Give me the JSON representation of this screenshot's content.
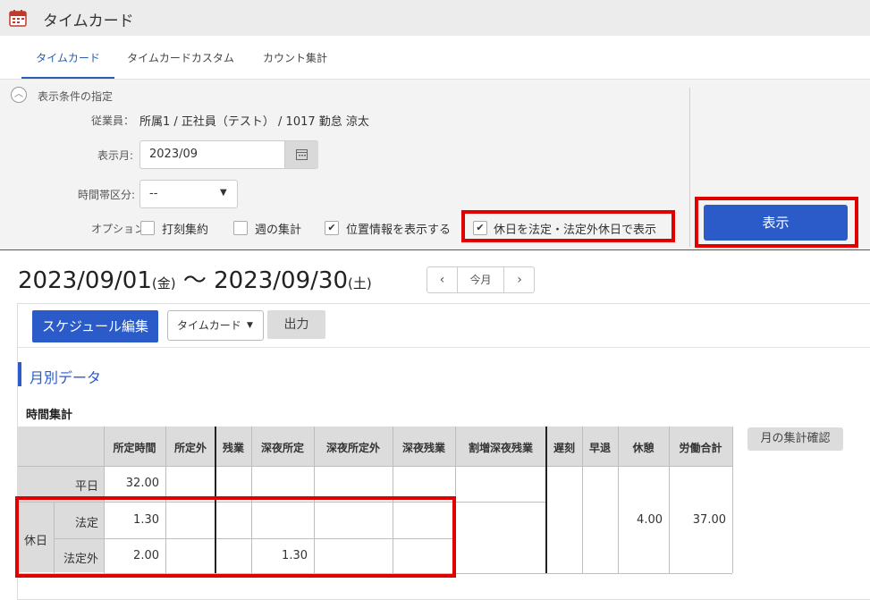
{
  "app": {
    "title": "タイムカード"
  },
  "tabs": [
    {
      "label": "タイムカード",
      "active": true
    },
    {
      "label": "タイムカードカスタム",
      "active": false
    },
    {
      "label": "カウント集計",
      "active": false
    }
  ],
  "conditions": {
    "section_label": "表示条件の指定",
    "employee_label": "従業員：",
    "employee_value": "所属1 / 正社員（テスト） / 1017 勤怠 涼太",
    "month_label": "表示月:",
    "month_value": "2023/09",
    "timeslot_label": "時間帯区分:",
    "timeslot_value": "--",
    "options_label": "オプション:",
    "options": [
      {
        "label": "打刻集約",
        "checked": false
      },
      {
        "label": "週の集計",
        "checked": false
      },
      {
        "label": "位置情報を表示する",
        "checked": true
      },
      {
        "label": "休日を法定・法定外休日で表示",
        "checked": true
      }
    ],
    "show_button": "表示"
  },
  "range": {
    "start": "2023/09/01",
    "start_day": "(金)",
    "sep": "〜",
    "end": "2023/09/30",
    "end_day": "(土)",
    "prev": "‹",
    "today": "今月",
    "next": "›"
  },
  "toolbar": {
    "schedule_button": "スケジュール編集",
    "view_select": "タイムカード",
    "output_button": "出力"
  },
  "monthly": {
    "section_title": "月別データ",
    "table_title": "時間集計",
    "confirm_button": "月の集計確認",
    "columns": [
      "所定時間",
      "所定外",
      "残業",
      "深夜所定",
      "深夜所定外",
      "深夜残業",
      "割増深夜残業",
      "遅刻",
      "早退",
      "休憩",
      "労働合計"
    ],
    "rows": {
      "weekday_label": "平日",
      "weekday_scheduled": "32.00",
      "holiday_label": "休日",
      "legal_label": "法定",
      "legal_scheduled": "1.30",
      "nonlegal_label": "法定外",
      "nonlegal_scheduled": "2.00",
      "nonlegal_night_scheduled": "1.30",
      "break_total": "4.00",
      "work_total": "37.00"
    }
  },
  "colors": {
    "accent": "#2a5bc9",
    "highlight": "#e00000"
  }
}
